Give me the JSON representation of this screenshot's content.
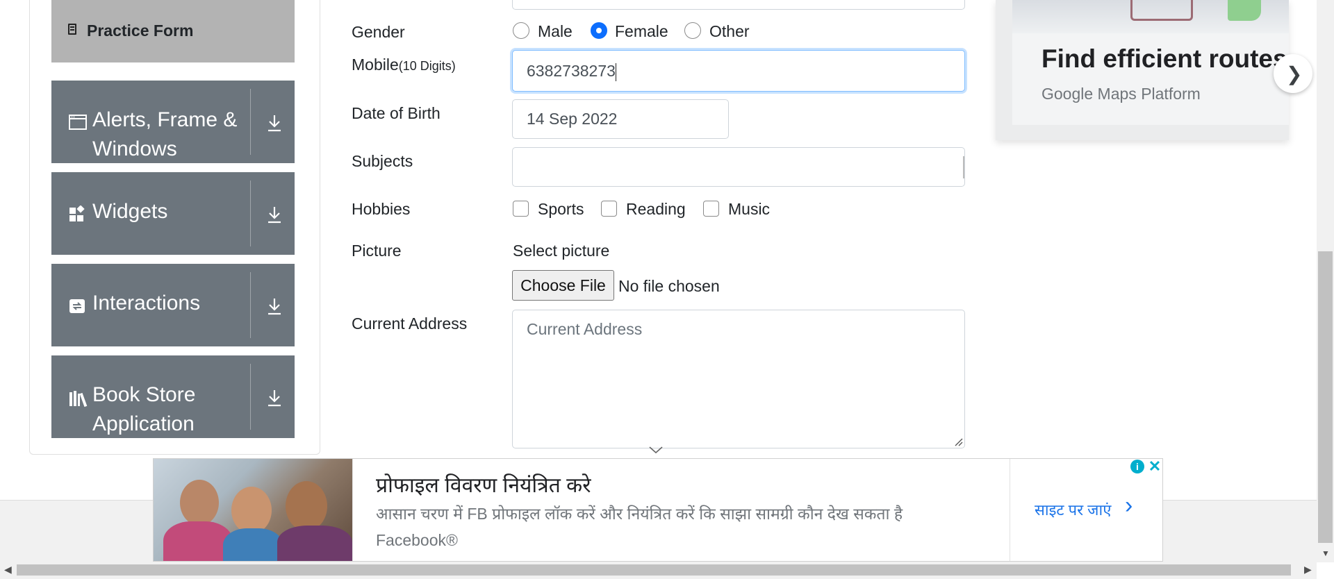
{
  "sidebar": {
    "practice_form": "Practice Form",
    "groups": [
      {
        "line1": "Alerts, Frame &",
        "line2": "Windows",
        "icon": "window-icon"
      },
      {
        "line1": "Widgets",
        "line2": "",
        "icon": "widgets-icon"
      },
      {
        "line1": "Interactions",
        "line2": "",
        "icon": "interactions-icon"
      },
      {
        "line1": "Book Store",
        "line2": "Application",
        "icon": "books-icon"
      }
    ]
  },
  "form": {
    "gender_label": "Gender",
    "gender_options": [
      "Male",
      "Female",
      "Other"
    ],
    "gender_selected": "Female",
    "mobile_label": "Mobile",
    "mobile_hint": "(10 Digits)",
    "mobile_value": "6382738273",
    "dob_label": "Date of Birth",
    "dob_value": "14 Sep 2022",
    "subjects_label": "Subjects",
    "subjects_value": "",
    "hobbies_label": "Hobbies",
    "hobbies": [
      "Sports",
      "Reading",
      "Music"
    ],
    "picture_label": "Picture",
    "picture_select": "Select picture",
    "choose_file": "Choose File",
    "no_file": "No file chosen",
    "address_label": "Current Address",
    "address_placeholder": "Current Address"
  },
  "map_ad": {
    "title": "Find efficient routes",
    "subtitle": "Google Maps Platform"
  },
  "banner_ad": {
    "title": "प्रोफाइल विवरण नियंत्रित करे",
    "description": "आसान चरण में FB प्रोफाइल लॉक करें और नियंत्रित करें कि साझा सामग्री कौन देख सकता है",
    "brand": "Facebook®",
    "cta": "साइट पर जाएं"
  },
  "colors": {
    "sidebar_group": "#6c757d",
    "practice_active": "#b3b3b3",
    "focus_border": "#80bdff",
    "radio_selected": "#0d6efd",
    "link_blue": "#1a73e8"
  }
}
